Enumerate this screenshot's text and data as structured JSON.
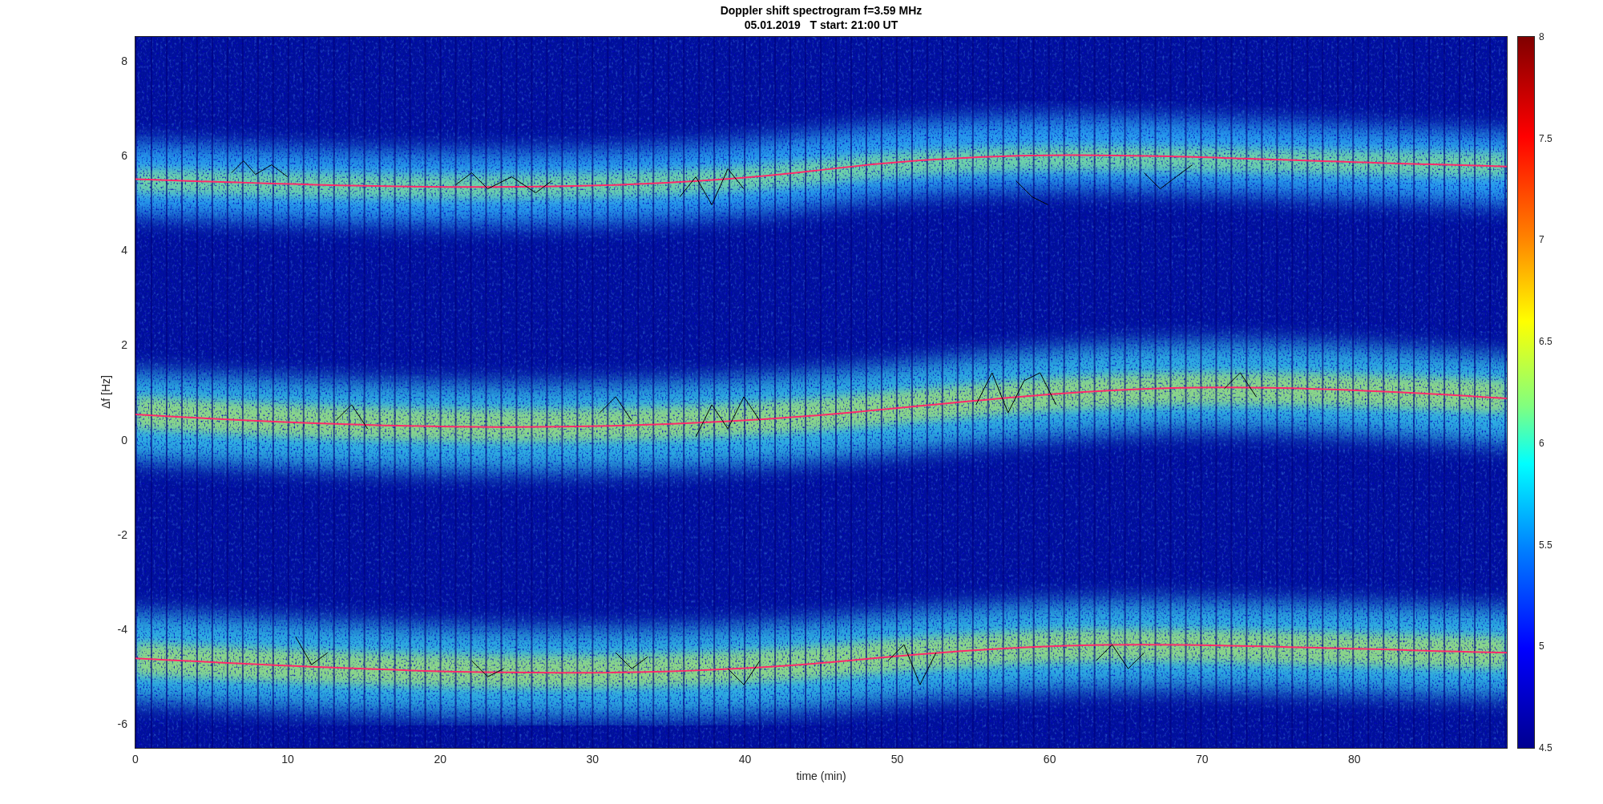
{
  "figure": {
    "title": [
      "Doppler shift spectrogram f=3.59 MHz",
      "05.01.2019   T start: 21:00 UT"
    ]
  },
  "axes": {
    "ylabel": "Δf [Hz]",
    "xlabel": "time (min)",
    "xticks": [
      "0",
      "10",
      "20",
      "30",
      "40",
      "50",
      "60",
      "70",
      "80"
    ],
    "yticks": [
      "8",
      "6",
      "4",
      "2",
      "0",
      "-2",
      "-4",
      "-6"
    ]
  },
  "colorbar": {
    "ticks": [
      "8",
      "7.5",
      "7",
      "6.5",
      "6",
      "5.5",
      "5",
      "4.5"
    ]
  }
}
